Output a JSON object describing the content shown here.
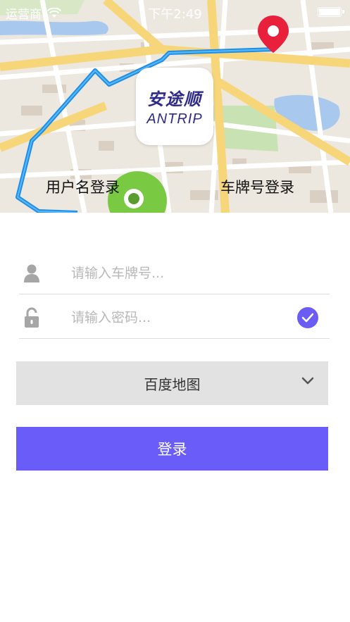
{
  "status_bar": {
    "carrier": "运营商",
    "time": "下午2:49"
  },
  "logo": {
    "cn": "安途顺",
    "en": "ANTRIP"
  },
  "tabs": {
    "username_login": "用户名登录",
    "plate_login": "车牌号登录"
  },
  "form": {
    "plate_placeholder": "请输入车牌号...",
    "password_placeholder": "请输入密码...",
    "remember_checked": true
  },
  "map_select": {
    "selected": "百度地图"
  },
  "login_button": "登录",
  "colors": {
    "accent": "#6a5cf8",
    "select_bg": "#e2e2e2",
    "route": "#1e8ee6",
    "pin": "#e8203c",
    "start_marker": "#7ac943"
  }
}
